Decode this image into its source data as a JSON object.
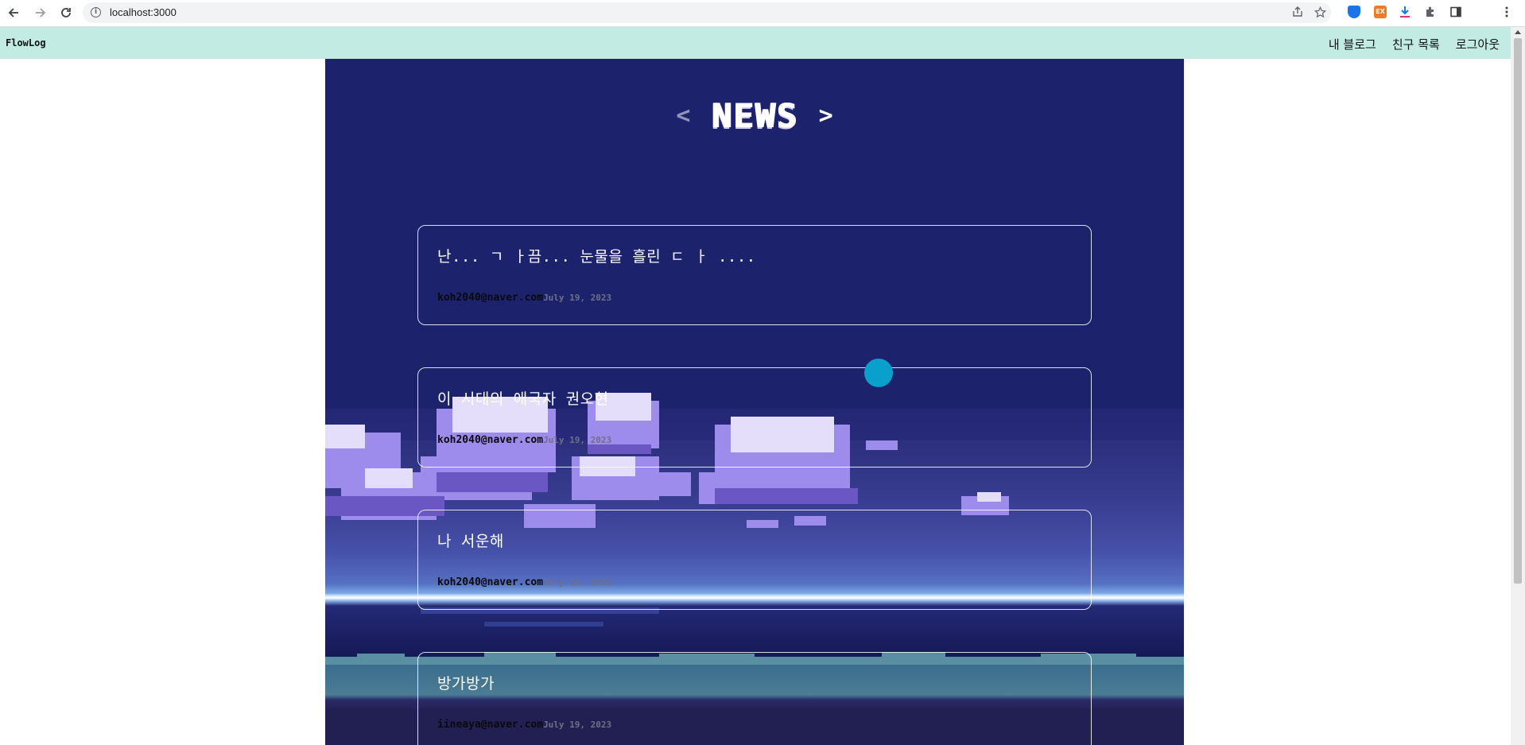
{
  "browser": {
    "url": "localhost:3000",
    "ext_badge": "EX"
  },
  "app": {
    "brand": "FlowLog",
    "nav": [
      "내 블로그",
      "친구 목록",
      "로그아웃"
    ]
  },
  "news": {
    "title": "NEWS",
    "prev": "<",
    "next": ">"
  },
  "posts": [
    {
      "title": "난... ㄱ ㅏ끔... 눈물을 흘린 ㄷ ㅏ ....",
      "author": "koh2040@naver.com",
      "date": "July 19, 2023"
    },
    {
      "title": "이 시대의 애국자 권오현",
      "author": "koh2040@naver.com",
      "date": "July 19, 2023"
    },
    {
      "title": "나 서운해",
      "author": "koh2040@naver.com",
      "date": "July 19, 2023"
    },
    {
      "title": "방가방가",
      "author": "iineaya@naver.com",
      "date": "July 19, 2023"
    }
  ],
  "colors": {
    "header_bg": "#c2ece3",
    "panel_bg": "#1d226c",
    "cursor": "#0aa0cc"
  },
  "icons": [
    "back-icon",
    "forward-icon",
    "reload-icon",
    "info-icon",
    "share-icon",
    "star-icon",
    "shield-extension-icon",
    "download-icon",
    "puzzle-icon",
    "sidepanel-icon",
    "menu-icon"
  ]
}
